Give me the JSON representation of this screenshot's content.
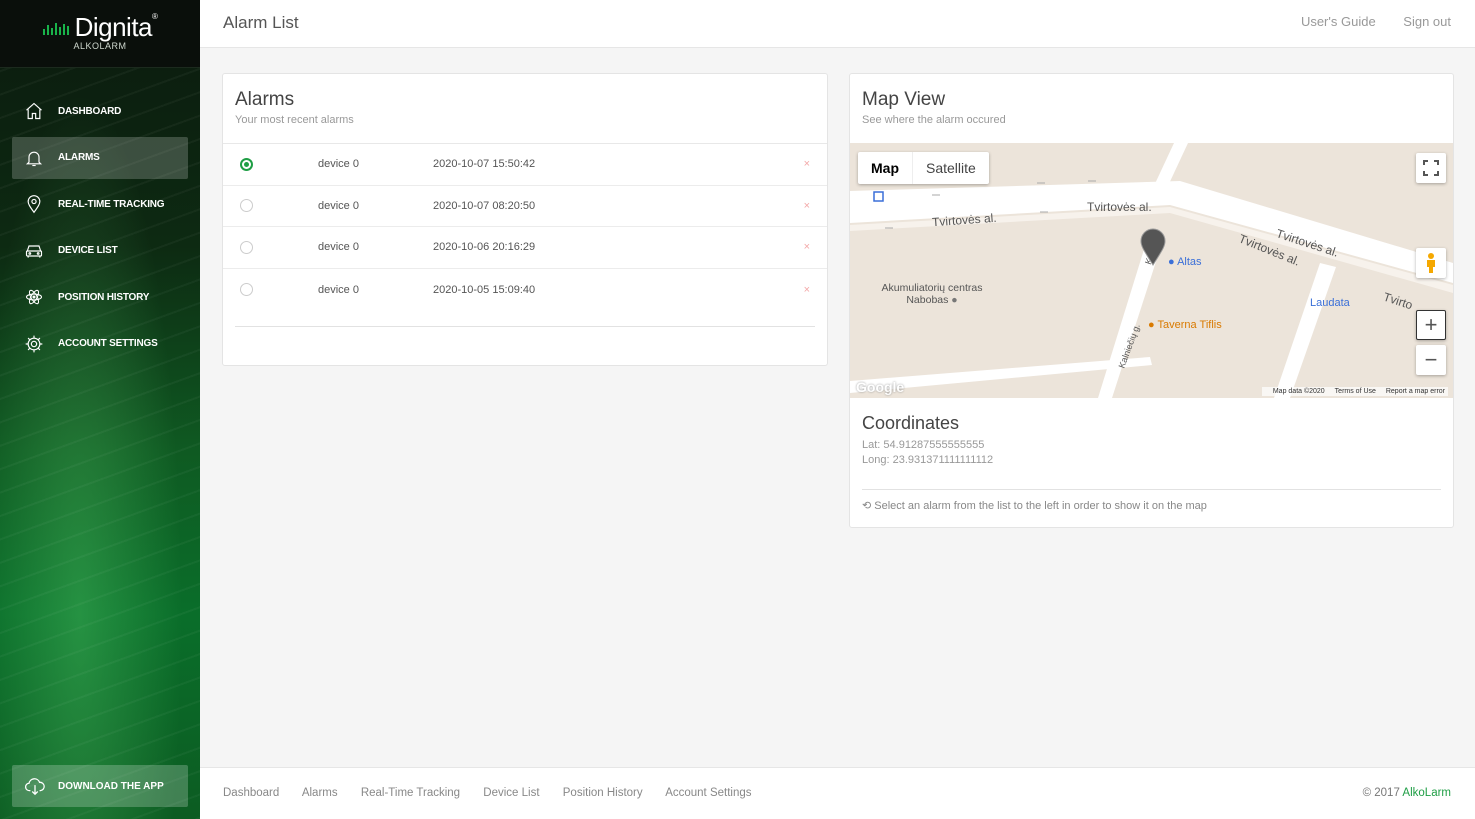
{
  "brand": {
    "name": "Dignita",
    "reg": "®",
    "sub": "ALKOLARM",
    "accent": "#1f9e45"
  },
  "sidebar": {
    "items": [
      {
        "label": "DASHBOARD",
        "icon": "home-icon",
        "active": false
      },
      {
        "label": "ALARMS",
        "icon": "bell-icon",
        "active": true
      },
      {
        "label": "REAL-TIME TRACKING",
        "icon": "map-pin-icon",
        "active": false
      },
      {
        "label": "DEVICE LIST",
        "icon": "car-icon",
        "active": false
      },
      {
        "label": "POSITION HISTORY",
        "icon": "atom-icon",
        "active": false
      },
      {
        "label": "ACCOUNT SETTINGS",
        "icon": "gear-icon",
        "active": false
      }
    ],
    "download_label": "DOWNLOAD THE APP"
  },
  "header": {
    "title": "Alarm List",
    "links": [
      "User's Guide",
      "Sign out"
    ]
  },
  "alarms": {
    "title": "Alarms",
    "subtitle": "Your most recent alarms",
    "rows": [
      {
        "device": "device 0",
        "time": "2020-10-07 15:50:42",
        "selected": true,
        "delete": "×"
      },
      {
        "device": "device 0",
        "time": "2020-10-07 08:20:50",
        "selected": false,
        "delete": "×"
      },
      {
        "device": "device 0",
        "time": "2020-10-06 20:16:29",
        "selected": false,
        "delete": "×"
      },
      {
        "device": "device 0",
        "time": "2020-10-05 15:09:40",
        "selected": false,
        "delete": "×"
      }
    ]
  },
  "map": {
    "title": "Map View",
    "subtitle": "See where the alarm occured",
    "type_buttons": [
      "Map",
      "Satellite"
    ],
    "streets": [
      "Tvirtovės al.",
      "Tvirtovės al.",
      "Tvirtovės al.",
      "Tvirtovės al.",
      "Tvirto",
      "Kalniečių g.",
      "Ka..g."
    ],
    "pois": [
      "Altas",
      "Akumuliatorių centras Nabobas",
      "Taverna Tiflis",
      "Laudata"
    ],
    "attribution": [
      "Map data ©2020",
      "Terms of Use",
      "Report a map error"
    ],
    "google": "Google",
    "zoom_in": "+",
    "zoom_out": "−"
  },
  "coordinates": {
    "title": "Coordinates",
    "lat": "Lat: 54.91287555555555",
    "long": "Long: 23.931371111111112",
    "hint": "Select an alarm from the list to the left in order to show it on the map"
  },
  "footer": {
    "links": [
      "Dashboard",
      "Alarms",
      "Real-Time Tracking",
      "Device List",
      "Position History",
      "Account Settings"
    ],
    "copyright_prefix": "© 2017",
    "copyright_brand": "AlkoLarm"
  }
}
